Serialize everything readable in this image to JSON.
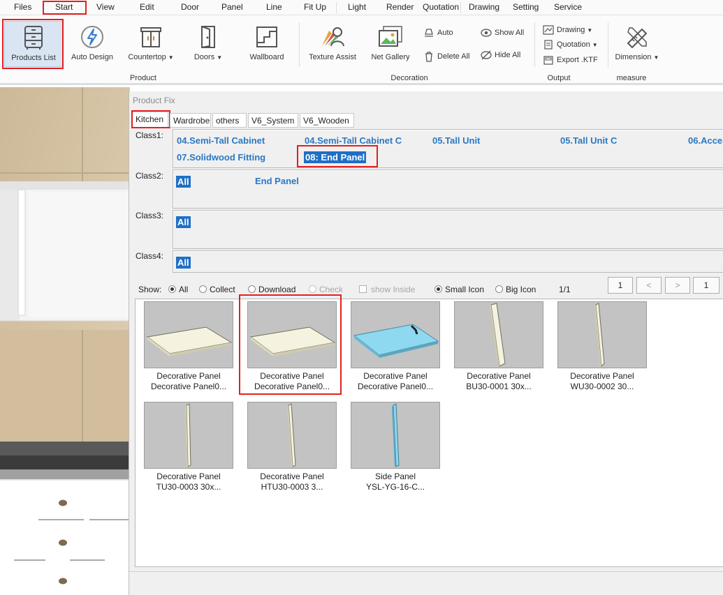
{
  "menu": {
    "items": [
      "Files",
      "Start",
      "View",
      "Edit",
      "Door",
      "Panel",
      "Line",
      "Fit Up",
      "Light",
      "Render",
      "Quotation",
      "Drawing",
      "Setting",
      "Service"
    ],
    "active": "Start"
  },
  "ribbon": {
    "products_list": "Products List",
    "auto_design": "Auto Design",
    "countertop": "Countertop",
    "doors": "Doors",
    "wallboard": "Wallboard",
    "texture_assist": "Texture Assist",
    "net_gallery": "Net Gallery",
    "auto": "Auto",
    "delete_all": "Delete All",
    "show_all": "Show All",
    "hide_all": "Hide All",
    "drawing": "Drawing",
    "quotation": "Quotation",
    "export_ktf": "Export .KTF",
    "dimension": "Dimension",
    "groups": {
      "product": "Product",
      "decoration": "Decoration",
      "output": "Output",
      "measure": "measure"
    }
  },
  "dialog": {
    "title": "Product Fix",
    "tabs": [
      "Kitchen",
      "Wardrobe",
      "others",
      "V6_System",
      "V6_Wooden"
    ],
    "active_tab": "Kitchen",
    "class1_label": "Class1:",
    "class2_label": "Class2:",
    "class3_label": "Class3:",
    "class4_label": "Class4:",
    "class1_items": [
      "04.Semi-Tall Cabinet",
      "04.Semi-Tall Cabinet C",
      "05.Tall Unit",
      "05.Tall Unit C",
      "06.Acce",
      "07.Solidwood Fitting",
      "08: End Panel"
    ],
    "class1_selected": "08: End Panel",
    "class2_items": [
      "All",
      "End Panel"
    ],
    "class3_items": [
      "All"
    ],
    "class4_items": [
      "All"
    ],
    "show": {
      "label": "Show:",
      "all": "All",
      "collect": "Collect",
      "download": "Download",
      "check": "Check",
      "show_inside": "show Inside",
      "small_icon": "Small Icon",
      "big_icon": "Big Icon",
      "page_info": "1/1",
      "btn_first": "1",
      "btn_prev": "<",
      "btn_next": ">",
      "btn_last": "1"
    },
    "products": [
      {
        "line1": "Decorative Panel",
        "line2": "Decorative Panel0...",
        "kind": "flat"
      },
      {
        "line1": "Decorative Panel",
        "line2": "Decorative Panel0...",
        "kind": "flat"
      },
      {
        "line1": "Decorative Panel",
        "line2": "Decorative Panel0...",
        "kind": "glass"
      },
      {
        "line1": "Decorative Panel",
        "line2": "BU30-0001 30x...",
        "kind": "vertical-wide"
      },
      {
        "line1": "Decorative Panel",
        "line2": "WU30-0002 30...",
        "kind": "vertical"
      },
      {
        "line1": "Decorative Panel",
        "line2": "TU30-0003 30x...",
        "kind": "vertical"
      },
      {
        "line1": "Decorative Panel",
        "line2": "HTU30-0003 3...",
        "kind": "vertical"
      },
      {
        "line1": "Side Panel",
        "line2": "YSL-YG-16-C...",
        "kind": "vertical-blue"
      }
    ]
  },
  "colors": {
    "highlight_red": "#e41f1f",
    "class_link_blue": "#2b78c2",
    "selection_blue": "#1f6fc5"
  }
}
